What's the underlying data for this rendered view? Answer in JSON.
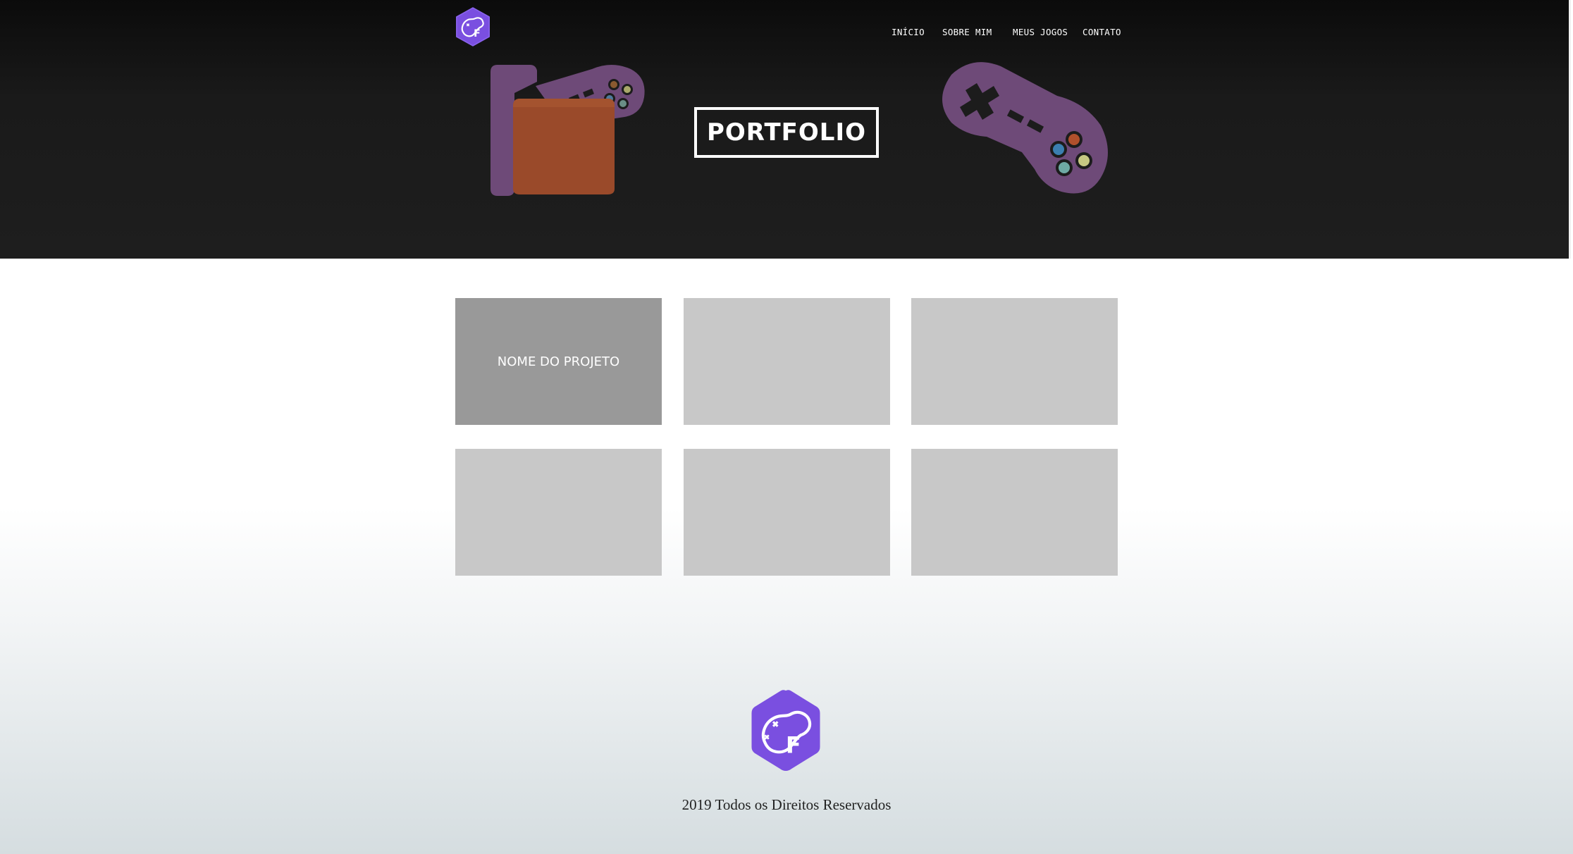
{
  "header": {
    "logo_icon": "gamepad-f-hex-logo-icon",
    "nav": {
      "inicio": "INÍCIO",
      "sobre_mim": "SOBRE MIM",
      "meus_jogos": "MEUS JOGOS",
      "contato": "CONTATO"
    }
  },
  "hero": {
    "title": "PORTFOLIO",
    "left_art_icon": "folder-controller-icon",
    "right_art_icon": "game-controller-icon"
  },
  "projects": [
    {
      "label": "NOME DO PROJETO"
    },
    {
      "label": ""
    },
    {
      "label": ""
    },
    {
      "label": ""
    },
    {
      "label": ""
    },
    {
      "label": ""
    }
  ],
  "footer": {
    "logo_icon": "gamepad-f-hex-logo-icon",
    "copyright": "2019 Todos os Direitos Reservados"
  },
  "colors": {
    "brand_purple": "#7a4fe0",
    "controller_purple": "#6e4a78",
    "folder_orange": "#9a4a2a",
    "card_gray": "#c8c8c8",
    "card_hover_gray": "#999999"
  }
}
